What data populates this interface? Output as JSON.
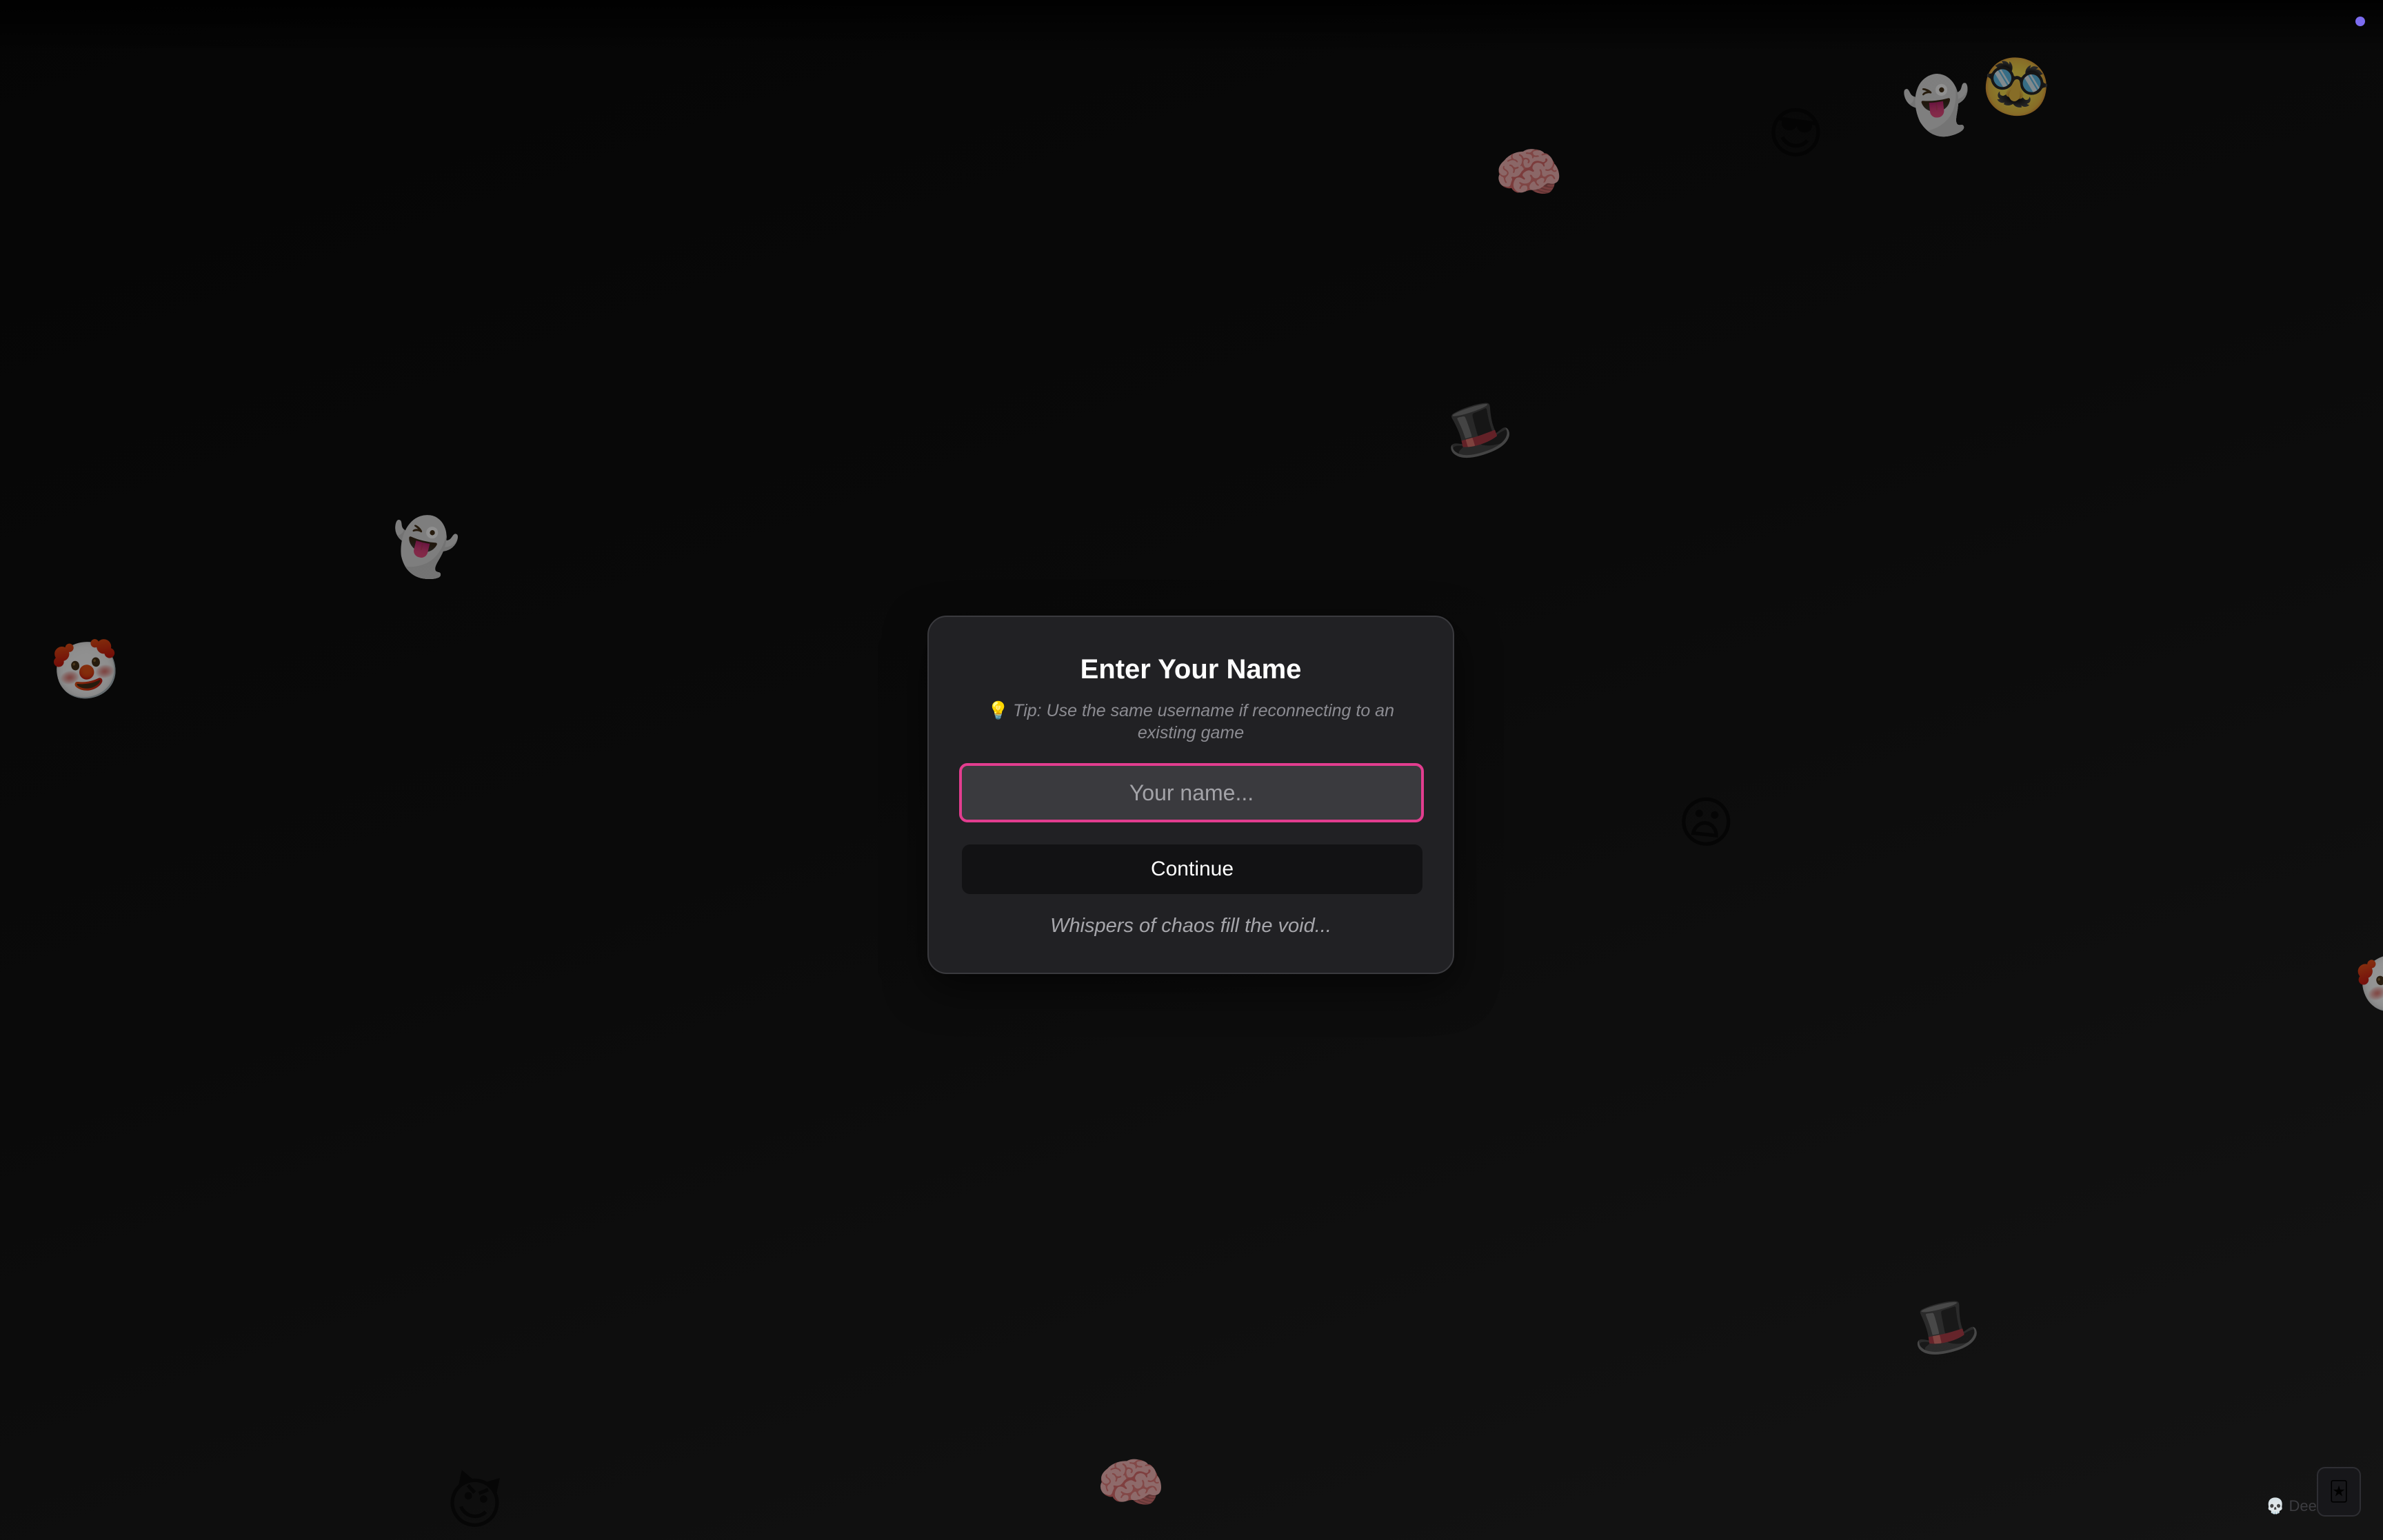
{
  "modal": {
    "title": "Enter Your Name",
    "tip_icon": "💡",
    "tip": "Tip: Use the same username if reconnecting to an existing game",
    "name_input": {
      "value": "",
      "placeholder": "Your name..."
    },
    "continue_label": "Continue",
    "flavor_text": "Whispers of chaos fill the void..."
  },
  "floating_emojis": [
    {
      "name": "brain-icon",
      "glyph": "🧠"
    },
    {
      "name": "sunglasses-face-icon",
      "glyph": "😎"
    },
    {
      "name": "pirate-ghost-icon",
      "glyph": "👻"
    },
    {
      "name": "disguised-face-icon",
      "glyph": "🥸"
    },
    {
      "name": "top-hat-icon",
      "glyph": "🎩"
    },
    {
      "name": "ghost-icon",
      "glyph": "👻"
    },
    {
      "name": "clown-face-icon",
      "glyph": "🤡"
    },
    {
      "name": "sad-purple-face-icon",
      "glyph": "😦"
    },
    {
      "name": "top-hat-icon",
      "glyph": "🎩"
    },
    {
      "name": "imp-icon",
      "glyph": "😈"
    },
    {
      "name": "brain-icon",
      "glyph": "🧠"
    },
    {
      "name": "clown-face-icon",
      "glyph": "🤡"
    }
  ],
  "footer": {
    "skull_icon": "💀",
    "credit_text": "Dee"
  },
  "corner_widget": {
    "icon": "🃏"
  },
  "colors": {
    "background": "#0a0a0a",
    "modal_bg": "#212124",
    "input_bg": "#3a3a3e",
    "input_border": "#e23d8f",
    "button_bg": "#121214",
    "status_dot": "#7c6cf0"
  }
}
